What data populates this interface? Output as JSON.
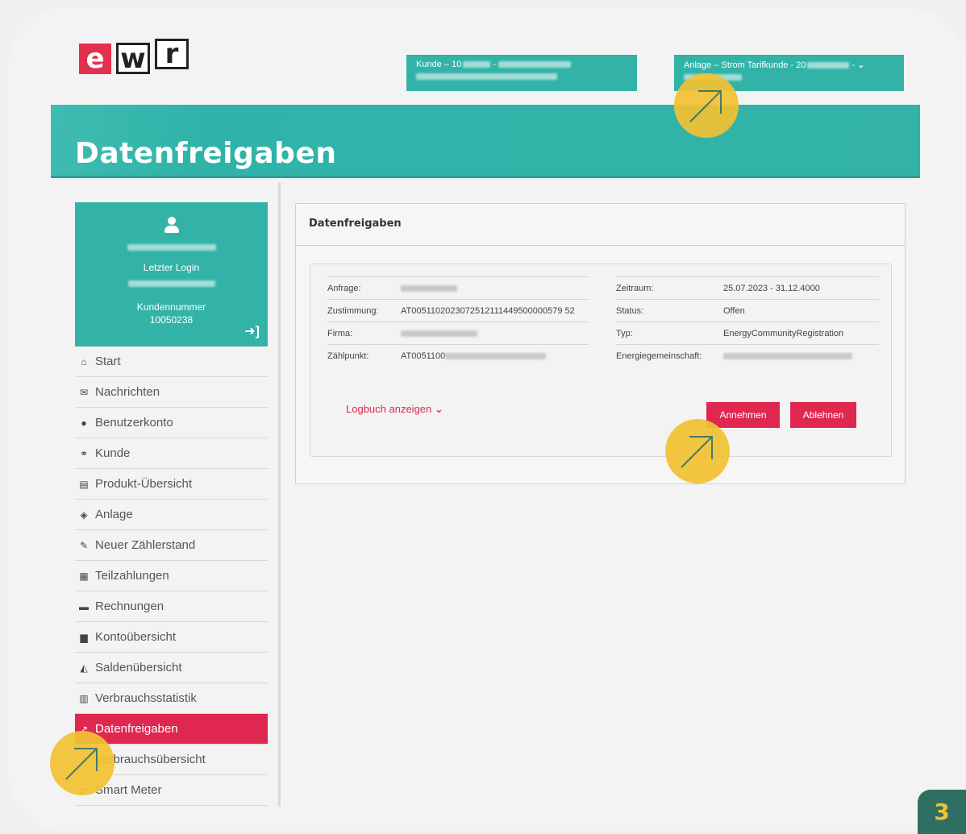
{
  "logo": {
    "l1": "e",
    "l2": "w",
    "l3": "r"
  },
  "header": {
    "kunde_prefix": "Kunde  –  10",
    "anlage_prefix": "Anlage  –  Strom Tarifkunde - 20",
    "anlage_suffix": " -",
    "chevron": "⌄"
  },
  "page_title": "Datenfreigaben",
  "user": {
    "last_login_label": "Letzter Login",
    "customer_no_label": "Kundennummer",
    "customer_no": "10050238",
    "logout_icon": "➜]"
  },
  "nav": [
    {
      "icon": "home-icon",
      "glyph": "⌂",
      "label": "Start"
    },
    {
      "icon": "envelope-icon",
      "glyph": "✉",
      "label": "Nachrichten"
    },
    {
      "icon": "user-icon",
      "glyph": "●",
      "label": "Benutzerkonto"
    },
    {
      "icon": "link-icon",
      "glyph": "⚭",
      "label": "Kunde"
    },
    {
      "icon": "file-icon",
      "glyph": "▤",
      "label": "Produkt-Übersicht"
    },
    {
      "icon": "cube-icon",
      "glyph": "◈",
      "label": "Anlage"
    },
    {
      "icon": "pencil-icon",
      "glyph": "✎",
      "label": "Neuer Zählerstand"
    },
    {
      "icon": "calculator-icon",
      "glyph": "▦",
      "label": "Teilzahlungen"
    },
    {
      "icon": "money-icon",
      "glyph": "▬",
      "label": "Rechnungen"
    },
    {
      "icon": "book-icon",
      "glyph": "▆",
      "label": "Kontoübersicht"
    },
    {
      "icon": "area-chart-icon",
      "glyph": "◭",
      "label": "Saldenübersicht"
    },
    {
      "icon": "bar-chart-icon",
      "glyph": "▥",
      "label": "Verbrauchsstatistik"
    },
    {
      "icon": "share-icon",
      "glyph": "↗",
      "label": "Datenfreigaben",
      "active": true
    },
    {
      "icon": "list-icon",
      "glyph": "≡",
      "label": "Verbrauchsübersicht"
    },
    {
      "icon": "arrows-icon",
      "glyph": "⇄",
      "label": "Smart Meter"
    }
  ],
  "panel": {
    "title": "Datenfreigaben",
    "left": [
      {
        "label": "Anfrage:",
        "value": ""
      },
      {
        "label": "Zustimmung:",
        "value": "AT0051102023072512111449500000579 52"
      },
      {
        "label": "Firma:",
        "value": ""
      },
      {
        "label": "Zählpunkt:",
        "value": "AT0051100"
      }
    ],
    "right": [
      {
        "label": "Zeitraum:",
        "value": "25.07.2023 - 31.12.4000"
      },
      {
        "label": "Status:",
        "value": "Offen"
      },
      {
        "label": "Typ:",
        "value": "EnergyCommunityRegistration"
      },
      {
        "label": "Energiegemeinschaft:",
        "value": ""
      }
    ],
    "logbuch": "Logbuch anzeigen",
    "accept": "Annehmen",
    "reject": "Ablehnen"
  },
  "page_number": "3",
  "colors": {
    "teal": "#33b3a8",
    "red": "#df2750",
    "marker": "#f1c233",
    "badge": "#2f6f63"
  }
}
